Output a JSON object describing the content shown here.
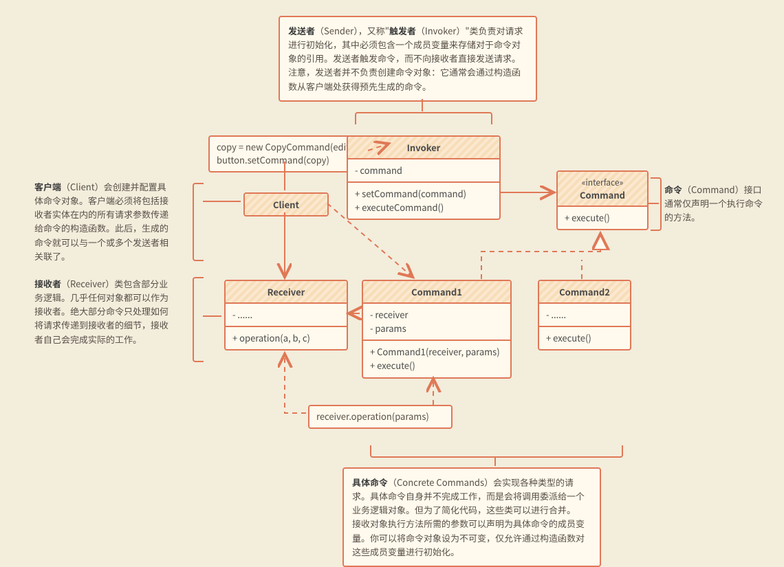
{
  "notes": {
    "sender": "<b>发送者</b>（Sender），又称\"<b>触发者</b>（Invoker）\"类负责对请求进行初始化，其中必须包含一个成员变量来存储对于命令对象的引用。发送者触发命令，而不向接收者直接发送请求。注意，发送者并不负责创建命令对象：它通常会通过构造函数从客户端处获得预先生成的命令。",
    "command": "<b>命令</b>（Command）接口通常仅声明一个执行命令的方法。",
    "concrete": "<b>具体命令</b>（Concrete Commands）会实现各种类型的请求。具体命令自身并不完成工作，而是会将调用委派给一个业务逻辑对象。但为了简化代码，这些类可以进行合并。<br>接收对象执行方法所需的参数可以声明为具体命令的成员变量。你可以将命令对象设为不可变，仅允许通过构造函数对这些成员变量进行初始化。",
    "client": "<b>客户端</b>（Client）会创建并配置具体命令对象。客户端必须将包括接收者实体在内的所有请求参数传递给命令的构造函数。此后，生成的命令就可以与一个或多个发送者相关联了。",
    "receiver": "<b>接收者</b>（Receiver）类包含部分业务逻辑。几乎任何对象都可以作为接收者。绝大部分命令只处理如何将请求传递到接收者的细节，接收者自己会完成实际的工作。"
  },
  "labels": {
    "copy": "copy = new CopyCommand(editor)\nbutton.setCommand(copy)",
    "recv": "receiver.operation(params)"
  },
  "uml": {
    "client": {
      "title": "Client"
    },
    "invoker": {
      "title": "Invoker",
      "fields": "- command",
      "ops": "+ setCommand(command)\n+ executeCommand()"
    },
    "iface": {
      "stereo": "«interface»",
      "title": "Command",
      "ops": "+ execute()"
    },
    "receiver": {
      "title": "Receiver",
      "fields": "- ......",
      "ops": "+ operation(a, b, c)"
    },
    "cmd1": {
      "title": "Command1",
      "fields": "- receiver\n- params",
      "ops": "+ Command1(receiver, params)\n+ execute()"
    },
    "cmd2": {
      "title": "Command2",
      "fields": "- ......",
      "ops": "+ execute()"
    }
  }
}
